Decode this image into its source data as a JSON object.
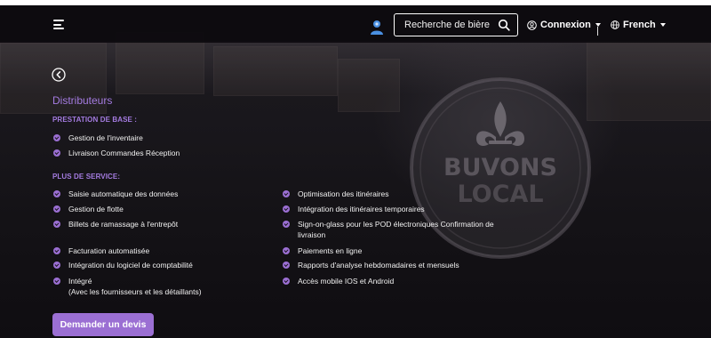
{
  "navbar": {
    "search_placeholder": "Recherche de bière",
    "login_label": "Connexion",
    "language_label": "French",
    "icons": [
      "hamburger-menu-icon",
      "user-icon",
      "search-icon",
      "user-circle-icon",
      "globe-icon",
      "chevron-down-icon"
    ]
  },
  "page": {
    "title": "Distributeurs",
    "base_label": "PRESTATION DE BASE :",
    "base_items": [
      "Gestion de l'inventaire",
      "Livraison Commandes Réception"
    ],
    "plus_label": "PLUS DE SERVICE:",
    "plus_left": [
      "Saisie automatique des données",
      "Gestion de flotte",
      "Billets de ramassage à l'entrepôt",
      "Facturation automatisée",
      "Intégration du logiciel de comptabilité",
      "Intégré",
      "(Avec les fournisseurs et les détaillants)"
    ],
    "plus_right": [
      "Optimisation des itinéraires",
      "Intégration des itinéraires temporaires",
      "Sign-on-glass pour les POD électroniques Confirmation de",
      "livraison",
      "Paiements en ligne",
      "Rapports d'analyse hebdomadaires et mensuels",
      "Accès mobile IOS et Android"
    ],
    "cta_label": "Demander un devis"
  },
  "background_logo": {
    "line1": "BUVONS",
    "line2": "LOCAL"
  },
  "colors": {
    "accent": "#9b6fd3",
    "accent_text": "#a47be0",
    "navbar_bg": "#0c0a0e",
    "hero_bg": "#19171c"
  }
}
